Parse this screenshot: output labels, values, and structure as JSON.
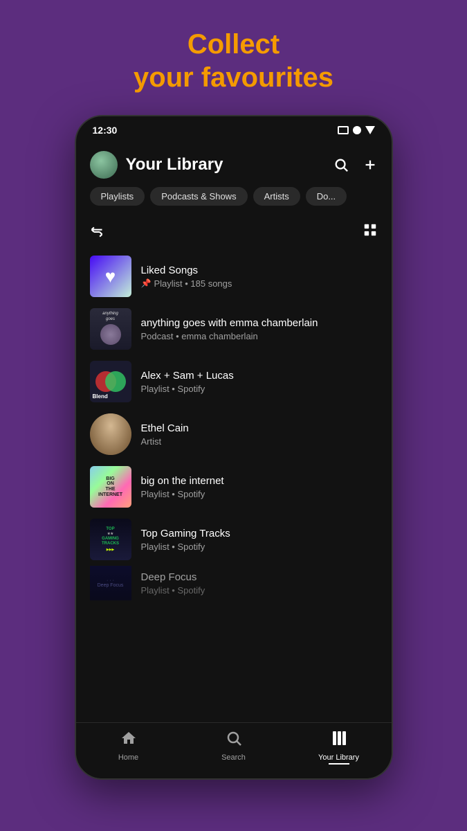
{
  "hero": {
    "line1": "Collect",
    "line2": "your favourites"
  },
  "statusBar": {
    "time": "12:30"
  },
  "header": {
    "title": "Your Library"
  },
  "filterTabs": [
    {
      "id": "playlists",
      "label": "Playlists"
    },
    {
      "id": "podcasts",
      "label": "Podcasts & Shows"
    },
    {
      "id": "artists",
      "label": "Artists"
    },
    {
      "id": "downloaded",
      "label": "Do..."
    }
  ],
  "libraryItems": [
    {
      "id": "liked-songs",
      "name": "Liked Songs",
      "meta": "Playlist • 185 songs",
      "type": "playlist",
      "pinned": true
    },
    {
      "id": "anything-goes",
      "name": "anything goes with emma chamberlain",
      "meta": "Podcast • emma chamberlain",
      "type": "podcast"
    },
    {
      "id": "alex-sam-lucas",
      "name": "Alex + Sam + Lucas",
      "meta": "Playlist • Spotify",
      "type": "blend"
    },
    {
      "id": "ethel-cain",
      "name": "Ethel Cain",
      "meta": "Artist",
      "type": "artist"
    },
    {
      "id": "big-internet",
      "name": "big on the internet",
      "meta": "Playlist • Spotify",
      "type": "playlist-cover"
    },
    {
      "id": "top-gaming",
      "name": "Top Gaming Tracks",
      "meta": "Playlist • Spotify",
      "type": "gaming"
    },
    {
      "id": "deep-focus",
      "name": "Deep Focus",
      "meta": "Playlist • Spotify",
      "type": "deep-focus"
    }
  ],
  "bottomNav": [
    {
      "id": "home",
      "label": "Home",
      "icon": "home",
      "active": false
    },
    {
      "id": "search",
      "label": "Search",
      "icon": "search",
      "active": false
    },
    {
      "id": "library",
      "label": "Your Library",
      "icon": "library",
      "active": true
    }
  ]
}
